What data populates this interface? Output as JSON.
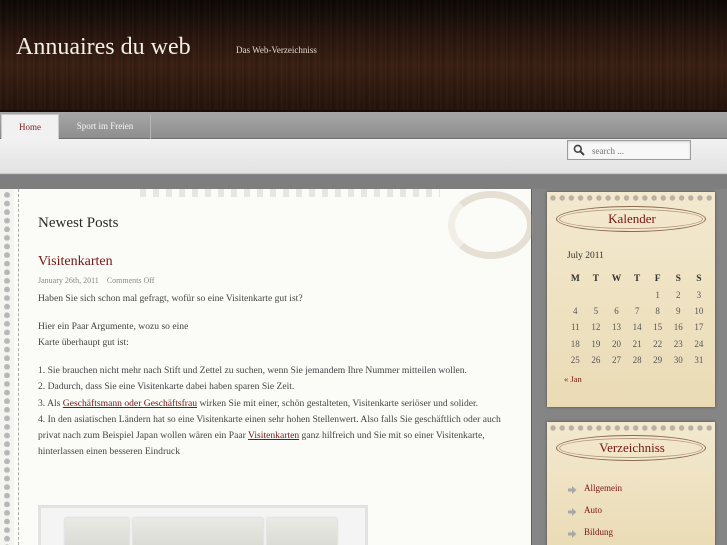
{
  "header": {
    "title": "Annuaires du web",
    "description": "Das Web-Verzeichniss"
  },
  "nav": {
    "tabs": [
      {
        "label": "Home",
        "active": true
      },
      {
        "label": "Sport im Freien",
        "active": false
      }
    ]
  },
  "search": {
    "placeholder": "search ..."
  },
  "main": {
    "heading": "Newest Posts",
    "post": {
      "title": "Visitenkarten",
      "date": "January 26th, 2011",
      "comments": "Comments Off",
      "p1": "Haben Sie sich schon mal gefragt, wofür so eine Visitenkarte gut ist?",
      "p2_line1": "Hier ein Paar Argumente, wozu so eine",
      "p2_line2": "Karte überhaupt gut ist:",
      "li1": "1. Sie brauchen nicht mehr nach Stift und Zettel zu suchen, wenn Sie jemandem Ihre Nummer mitteilen wollen.",
      "li2": "2. Dadurch, dass Sie eine Visitenkarte dabei haben sparen Sie Zeit.",
      "li3_pre": "3. Als ",
      "li3_link": "Geschäftsmann oder Geschäftsfrau",
      "li3_post": " wirken Sie mit einer, schön gestalteten, Visitenkarte seriöser und solider.",
      "li4_pre": "4. In den asiatischen Ländern hat so eine Visitenkarte einen sehr hohen Stellenwert. Also falls Sie geschäftlich oder auch privat nach zum Beispiel Japan wollen wären ein Paar ",
      "li4_link": "Visitenkarten",
      "li4_post": " ganz hilfreich und Sie mit so einer Visitenkarte, hinterlassen einen besseren Eindruck"
    }
  },
  "sidebar": {
    "calendar": {
      "title": "Kalender",
      "caption": "July 2011",
      "weekdays": [
        "M",
        "T",
        "W",
        "T",
        "F",
        "S",
        "S"
      ],
      "weeks": [
        [
          "",
          "",
          "",
          "",
          "1",
          "2",
          "3"
        ],
        [
          "4",
          "5",
          "6",
          "7",
          "8",
          "9",
          "10"
        ],
        [
          "11",
          "12",
          "13",
          "14",
          "15",
          "16",
          "17"
        ],
        [
          "18",
          "19",
          "20",
          "21",
          "22",
          "23",
          "24"
        ],
        [
          "25",
          "26",
          "27",
          "28",
          "29",
          "30",
          "31"
        ]
      ],
      "prev": "« Jan"
    },
    "directory": {
      "title": "Verzeichniss",
      "items": [
        "Allgemein",
        "Auto",
        "Bildung"
      ]
    }
  },
  "colors": {
    "accent": "#7a1512",
    "header_bg": "#2a160d",
    "paper": "#eadbb5"
  }
}
